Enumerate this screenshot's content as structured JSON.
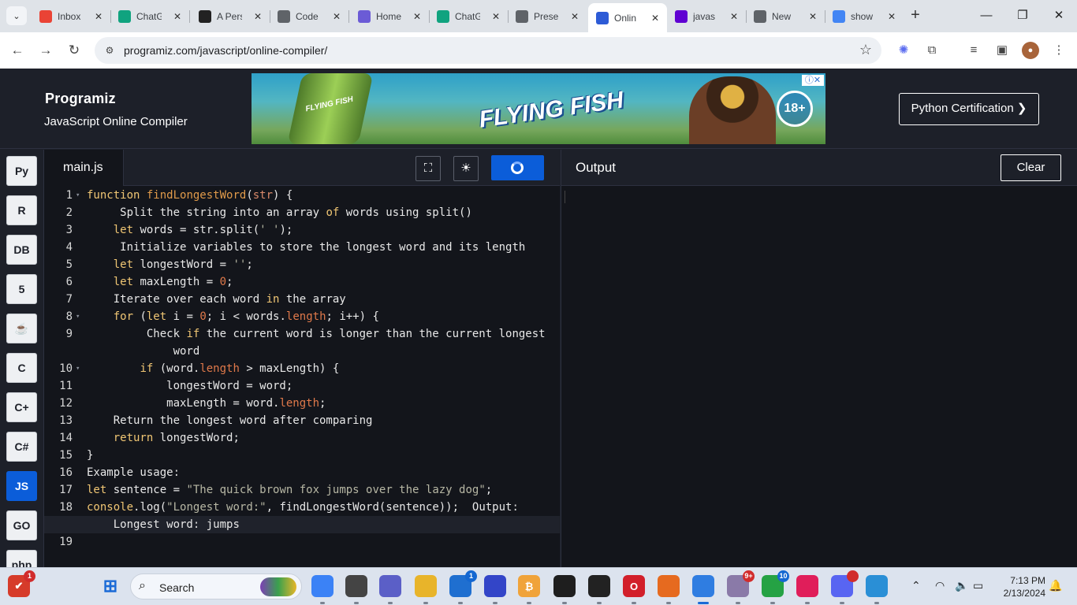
{
  "browser": {
    "tabs": [
      {
        "title": "Inbox",
        "icon": "gmail-icon",
        "color": "#ea4335"
      },
      {
        "title": "ChatG",
        "icon": "chatgpt-icon",
        "color": "#10a37f"
      },
      {
        "title": "A Pers",
        "icon": "perplexity-icon",
        "color": "#222222"
      },
      {
        "title": "Code",
        "icon": "globe-icon",
        "color": "#5f6368"
      },
      {
        "title": "Home",
        "icon": "home-icon",
        "color": "#6b5bd6"
      },
      {
        "title": "ChatG",
        "icon": "chatgpt-icon",
        "color": "#10a37f"
      },
      {
        "title": "Prese",
        "icon": "globe-icon",
        "color": "#5f6368"
      },
      {
        "title": "Onlin",
        "icon": "programiz-icon",
        "color": "#2d5bd6",
        "active": true
      },
      {
        "title": "javas",
        "icon": "yahoo-icon",
        "color": "#6001d2"
      },
      {
        "title": "New",
        "icon": "globe-icon",
        "color": "#5f6368"
      },
      {
        "title": "show",
        "icon": "google-icon",
        "color": "#4285f4"
      }
    ],
    "url": "programiz.com/javascript/online-compiler/"
  },
  "header": {
    "logo": "Programiz",
    "subtitle": "JavaScript Online Compiler",
    "cert_button": "Python Certification ❯",
    "ad": {
      "brand": "FLYING FISH",
      "bottle_label": "FLYING FISH",
      "age": "18+"
    }
  },
  "sidebar": {
    "languages": [
      {
        "name": "python",
        "glyph": "Py"
      },
      {
        "name": "r",
        "glyph": "R"
      },
      {
        "name": "sql",
        "glyph": "DB"
      },
      {
        "name": "html",
        "glyph": "5"
      },
      {
        "name": "java",
        "glyph": "☕"
      },
      {
        "name": "c",
        "glyph": "C"
      },
      {
        "name": "cpp",
        "glyph": "C+"
      },
      {
        "name": "csharp",
        "glyph": "C#"
      },
      {
        "name": "javascript",
        "glyph": "JS",
        "active": true
      },
      {
        "name": "go",
        "glyph": "GO"
      },
      {
        "name": "php",
        "glyph": "php"
      }
    ]
  },
  "editor": {
    "file_name": "main.js",
    "lines": [
      {
        "n": "1",
        "fold": true,
        "html": "<span class=\"kw\">function</span> <span class=\"fn\">findLongestWord</span>(<span class=\"pr\">str</span>) {"
      },
      {
        "n": "2",
        "html": "     Split the string into an array <span class=\"kw\">of</span> words using split()"
      },
      {
        "n": "3",
        "html": "    <span class=\"kw\">let</span> words = str.split(<span class=\"st\">' '</span>);"
      },
      {
        "n": "4",
        "html": "     Initialize variables to store the longest word and its length"
      },
      {
        "n": "5",
        "html": "    <span class=\"kw\">let</span> longestWord = <span class=\"st\">''</span>;"
      },
      {
        "n": "6",
        "html": "    <span class=\"kw\">let</span> maxLength = <span class=\"nm\">0</span>;"
      },
      {
        "n": "7",
        "html": "    Iterate over each word <span class=\"kw\">in</span> the array"
      },
      {
        "n": "8",
        "fold": true,
        "html": "    <span class=\"kw\">for</span> (<span class=\"kw\">let</span> i = <span class=\"nm\">0</span>; i &lt; words.<span class=\"nm\">length</span>; i++) {"
      },
      {
        "n": "9",
        "html": "         Check <span class=\"kw\">if</span> the current word is longer than the current longest"
      },
      {
        "n": "",
        "html": "             word"
      },
      {
        "n": "10",
        "fold": true,
        "html": "        <span class=\"kw\">if</span> (word.<span class=\"nm\">length</span> &gt; maxLength) {"
      },
      {
        "n": "11",
        "html": "            longestWord = word;"
      },
      {
        "n": "12",
        "html": "            maxLength = word.<span class=\"nm\">length</span>;"
      },
      {
        "n": "13",
        "html": "    Return the longest word after comparing"
      },
      {
        "n": "14",
        "html": "    <span class=\"kw\">return</span> longestWord;"
      },
      {
        "n": "15",
        "html": "}"
      },
      {
        "n": "16",
        "html": "Example usage<span class=\"ogray\">:</span>"
      },
      {
        "n": "17",
        "html": "<span class=\"kw\">let</span> sentence = <span class=\"st\">\"The quick brown fox jumps over the lazy dog\"</span>;"
      },
      {
        "n": "18",
        "html": "<span class=\"kw\">console</span>.log(<span class=\"st\">\"Longest word:\"</span>, findLongestWord(sentence));  Output<span class=\"ogray\">:</span>"
      },
      {
        "n": "",
        "current": true,
        "html": "    Longest word<span class=\"ogray\">:</span> jumps"
      },
      {
        "n": "19",
        "html": ""
      }
    ]
  },
  "output": {
    "title": "Output",
    "clear_label": "Clear"
  },
  "taskbar": {
    "search_placeholder": "Search",
    "apps": [
      {
        "name": "copilot-app",
        "glyph": "",
        "color": "#3b82f6"
      },
      {
        "name": "file-manager-app",
        "glyph": "",
        "color": "#444"
      },
      {
        "name": "teams-app",
        "glyph": "",
        "color": "#5b5fc7"
      },
      {
        "name": "file-explorer-app",
        "glyph": "",
        "color": "#e8b42a"
      },
      {
        "name": "store-app",
        "glyph": "",
        "color": "#1f6fd0",
        "badge": "1",
        "badge_blue": true
      },
      {
        "name": "editor-app",
        "glyph": "",
        "color": "#3345c8"
      },
      {
        "name": "bitcoin-app",
        "glyph": "₿",
        "color": "#f0a33a"
      },
      {
        "name": "figma-app",
        "glyph": "",
        "color": "#1e1e1e"
      },
      {
        "name": "github-app",
        "glyph": "",
        "color": "#222"
      },
      {
        "name": "opera-app",
        "glyph": "O",
        "color": "#d21f2a"
      },
      {
        "name": "firefox-app",
        "glyph": "",
        "color": "#e66a1f"
      },
      {
        "name": "chrome-app",
        "glyph": "",
        "color": "#2f7de1",
        "active": true
      },
      {
        "name": "photos-app",
        "glyph": "",
        "color": "#8a7aa8",
        "badge": "9+"
      },
      {
        "name": "whatsapp-app",
        "glyph": "",
        "color": "#25a244",
        "badge": "10",
        "badge_blue": true
      },
      {
        "name": "slack-app",
        "glyph": "",
        "color": "#e01e5a"
      },
      {
        "name": "discord-app",
        "glyph": "",
        "color": "#5865f2",
        "badge": " "
      },
      {
        "name": "notepad-app",
        "glyph": "",
        "color": "#2a8fd6"
      }
    ],
    "time": "7:13 PM",
    "date": "2/13/2024",
    "vscode_badge": "1"
  }
}
